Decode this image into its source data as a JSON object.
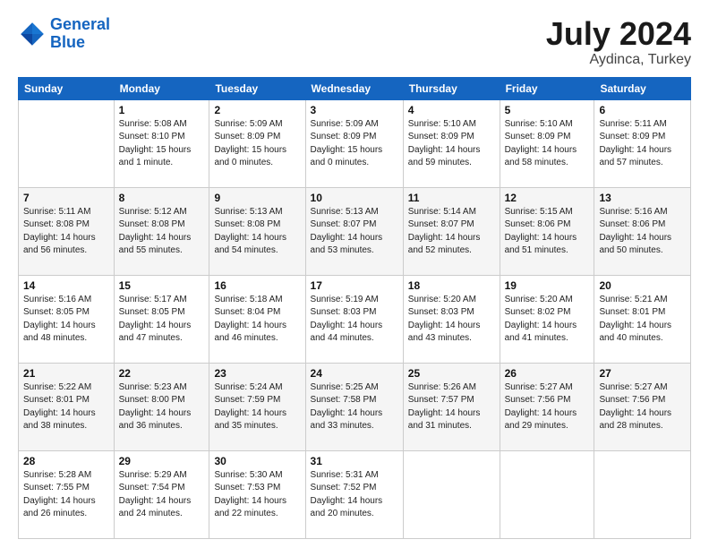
{
  "header": {
    "logo_line1": "General",
    "logo_line2": "Blue",
    "month_year": "July 2024",
    "location": "Aydinca, Turkey"
  },
  "weekdays": [
    "Sunday",
    "Monday",
    "Tuesday",
    "Wednesday",
    "Thursday",
    "Friday",
    "Saturday"
  ],
  "weeks": [
    [
      {
        "num": "",
        "info": ""
      },
      {
        "num": "1",
        "info": "Sunrise: 5:08 AM\nSunset: 8:10 PM\nDaylight: 15 hours\nand 1 minute."
      },
      {
        "num": "2",
        "info": "Sunrise: 5:09 AM\nSunset: 8:09 PM\nDaylight: 15 hours\nand 0 minutes."
      },
      {
        "num": "3",
        "info": "Sunrise: 5:09 AM\nSunset: 8:09 PM\nDaylight: 15 hours\nand 0 minutes."
      },
      {
        "num": "4",
        "info": "Sunrise: 5:10 AM\nSunset: 8:09 PM\nDaylight: 14 hours\nand 59 minutes."
      },
      {
        "num": "5",
        "info": "Sunrise: 5:10 AM\nSunset: 8:09 PM\nDaylight: 14 hours\nand 58 minutes."
      },
      {
        "num": "6",
        "info": "Sunrise: 5:11 AM\nSunset: 8:09 PM\nDaylight: 14 hours\nand 57 minutes."
      }
    ],
    [
      {
        "num": "7",
        "info": "Sunrise: 5:11 AM\nSunset: 8:08 PM\nDaylight: 14 hours\nand 56 minutes."
      },
      {
        "num": "8",
        "info": "Sunrise: 5:12 AM\nSunset: 8:08 PM\nDaylight: 14 hours\nand 55 minutes."
      },
      {
        "num": "9",
        "info": "Sunrise: 5:13 AM\nSunset: 8:08 PM\nDaylight: 14 hours\nand 54 minutes."
      },
      {
        "num": "10",
        "info": "Sunrise: 5:13 AM\nSunset: 8:07 PM\nDaylight: 14 hours\nand 53 minutes."
      },
      {
        "num": "11",
        "info": "Sunrise: 5:14 AM\nSunset: 8:07 PM\nDaylight: 14 hours\nand 52 minutes."
      },
      {
        "num": "12",
        "info": "Sunrise: 5:15 AM\nSunset: 8:06 PM\nDaylight: 14 hours\nand 51 minutes."
      },
      {
        "num": "13",
        "info": "Sunrise: 5:16 AM\nSunset: 8:06 PM\nDaylight: 14 hours\nand 50 minutes."
      }
    ],
    [
      {
        "num": "14",
        "info": "Sunrise: 5:16 AM\nSunset: 8:05 PM\nDaylight: 14 hours\nand 48 minutes."
      },
      {
        "num": "15",
        "info": "Sunrise: 5:17 AM\nSunset: 8:05 PM\nDaylight: 14 hours\nand 47 minutes."
      },
      {
        "num": "16",
        "info": "Sunrise: 5:18 AM\nSunset: 8:04 PM\nDaylight: 14 hours\nand 46 minutes."
      },
      {
        "num": "17",
        "info": "Sunrise: 5:19 AM\nSunset: 8:03 PM\nDaylight: 14 hours\nand 44 minutes."
      },
      {
        "num": "18",
        "info": "Sunrise: 5:20 AM\nSunset: 8:03 PM\nDaylight: 14 hours\nand 43 minutes."
      },
      {
        "num": "19",
        "info": "Sunrise: 5:20 AM\nSunset: 8:02 PM\nDaylight: 14 hours\nand 41 minutes."
      },
      {
        "num": "20",
        "info": "Sunrise: 5:21 AM\nSunset: 8:01 PM\nDaylight: 14 hours\nand 40 minutes."
      }
    ],
    [
      {
        "num": "21",
        "info": "Sunrise: 5:22 AM\nSunset: 8:01 PM\nDaylight: 14 hours\nand 38 minutes."
      },
      {
        "num": "22",
        "info": "Sunrise: 5:23 AM\nSunset: 8:00 PM\nDaylight: 14 hours\nand 36 minutes."
      },
      {
        "num": "23",
        "info": "Sunrise: 5:24 AM\nSunset: 7:59 PM\nDaylight: 14 hours\nand 35 minutes."
      },
      {
        "num": "24",
        "info": "Sunrise: 5:25 AM\nSunset: 7:58 PM\nDaylight: 14 hours\nand 33 minutes."
      },
      {
        "num": "25",
        "info": "Sunrise: 5:26 AM\nSunset: 7:57 PM\nDaylight: 14 hours\nand 31 minutes."
      },
      {
        "num": "26",
        "info": "Sunrise: 5:27 AM\nSunset: 7:56 PM\nDaylight: 14 hours\nand 29 minutes."
      },
      {
        "num": "27",
        "info": "Sunrise: 5:27 AM\nSunset: 7:56 PM\nDaylight: 14 hours\nand 28 minutes."
      }
    ],
    [
      {
        "num": "28",
        "info": "Sunrise: 5:28 AM\nSunset: 7:55 PM\nDaylight: 14 hours\nand 26 minutes."
      },
      {
        "num": "29",
        "info": "Sunrise: 5:29 AM\nSunset: 7:54 PM\nDaylight: 14 hours\nand 24 minutes."
      },
      {
        "num": "30",
        "info": "Sunrise: 5:30 AM\nSunset: 7:53 PM\nDaylight: 14 hours\nand 22 minutes."
      },
      {
        "num": "31",
        "info": "Sunrise: 5:31 AM\nSunset: 7:52 PM\nDaylight: 14 hours\nand 20 minutes."
      },
      {
        "num": "",
        "info": ""
      },
      {
        "num": "",
        "info": ""
      },
      {
        "num": "",
        "info": ""
      }
    ]
  ]
}
